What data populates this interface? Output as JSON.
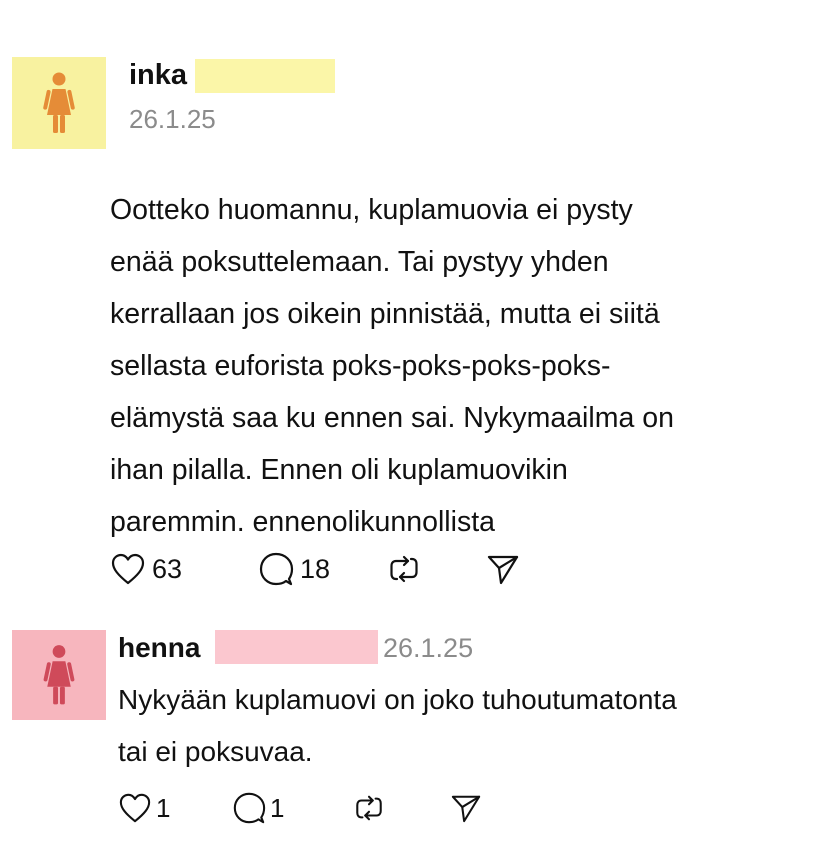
{
  "colors": {
    "avatar_yellow": "#f8f2a0",
    "avatar_pink": "#f7b6be",
    "figure_orange": "#e58c37",
    "figure_red": "#cf4a5a",
    "redact_yellow": "#fbf6a8",
    "redact_pink": "#fbc7cf",
    "date_gray": "#8b8b8b"
  },
  "posts": [
    {
      "author": "inka",
      "date": "26.1.25",
      "avatar_icon": "female-figure-icon",
      "text_lines": [
        "Ootteko huomannu, kuplamuovia ei pysty",
        "enää poksuttelemaan. Tai pystyy yhden",
        "kerrallaan jos oikein pinnistää, mutta ei siitä",
        "sellasta euforista poks-poks-poks-poks-",
        "elämystä saa ku ennen sai. Nykymaailma on",
        "ihan pilalla. Ennen oli kuplamuovikin",
        "paremmin. ennenolikunnollista"
      ],
      "likes": "63",
      "replies": "18"
    },
    {
      "author": "henna",
      "date": "26.1.25",
      "avatar_icon": "female-figure-icon",
      "text_lines": [
        "Nykyään kuplamuovi on joko tuhoutumatonta",
        "tai ei poksuvaa."
      ],
      "likes": "1",
      "replies": "1"
    }
  ]
}
